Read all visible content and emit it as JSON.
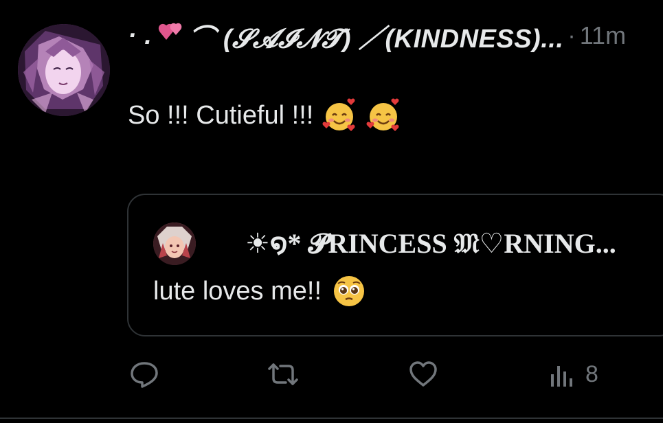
{
  "tweet": {
    "display_name_prefix": "· .",
    "display_name_main": "⌒ (𝓢𝓐𝓘𝓝𝓣) ／(KINDNESS)...",
    "separator": "·",
    "time": "11m",
    "text": "So !!! Cutieful !!!",
    "emojis": [
      "smiling-face-with-hearts",
      "smiling-face-with-hearts"
    ]
  },
  "quote": {
    "display_name": "☀︎໑* 𝓟RINCESS 𝔐♡RNING...",
    "text": "lute loves me!!",
    "emoji": "pleading-face"
  },
  "actions": {
    "views_count": "8"
  },
  "colors": {
    "background": "#000000",
    "text": "#e7e9ea",
    "muted": "#71767b",
    "border": "#2f3336",
    "heart_pink": "#e0568d"
  }
}
